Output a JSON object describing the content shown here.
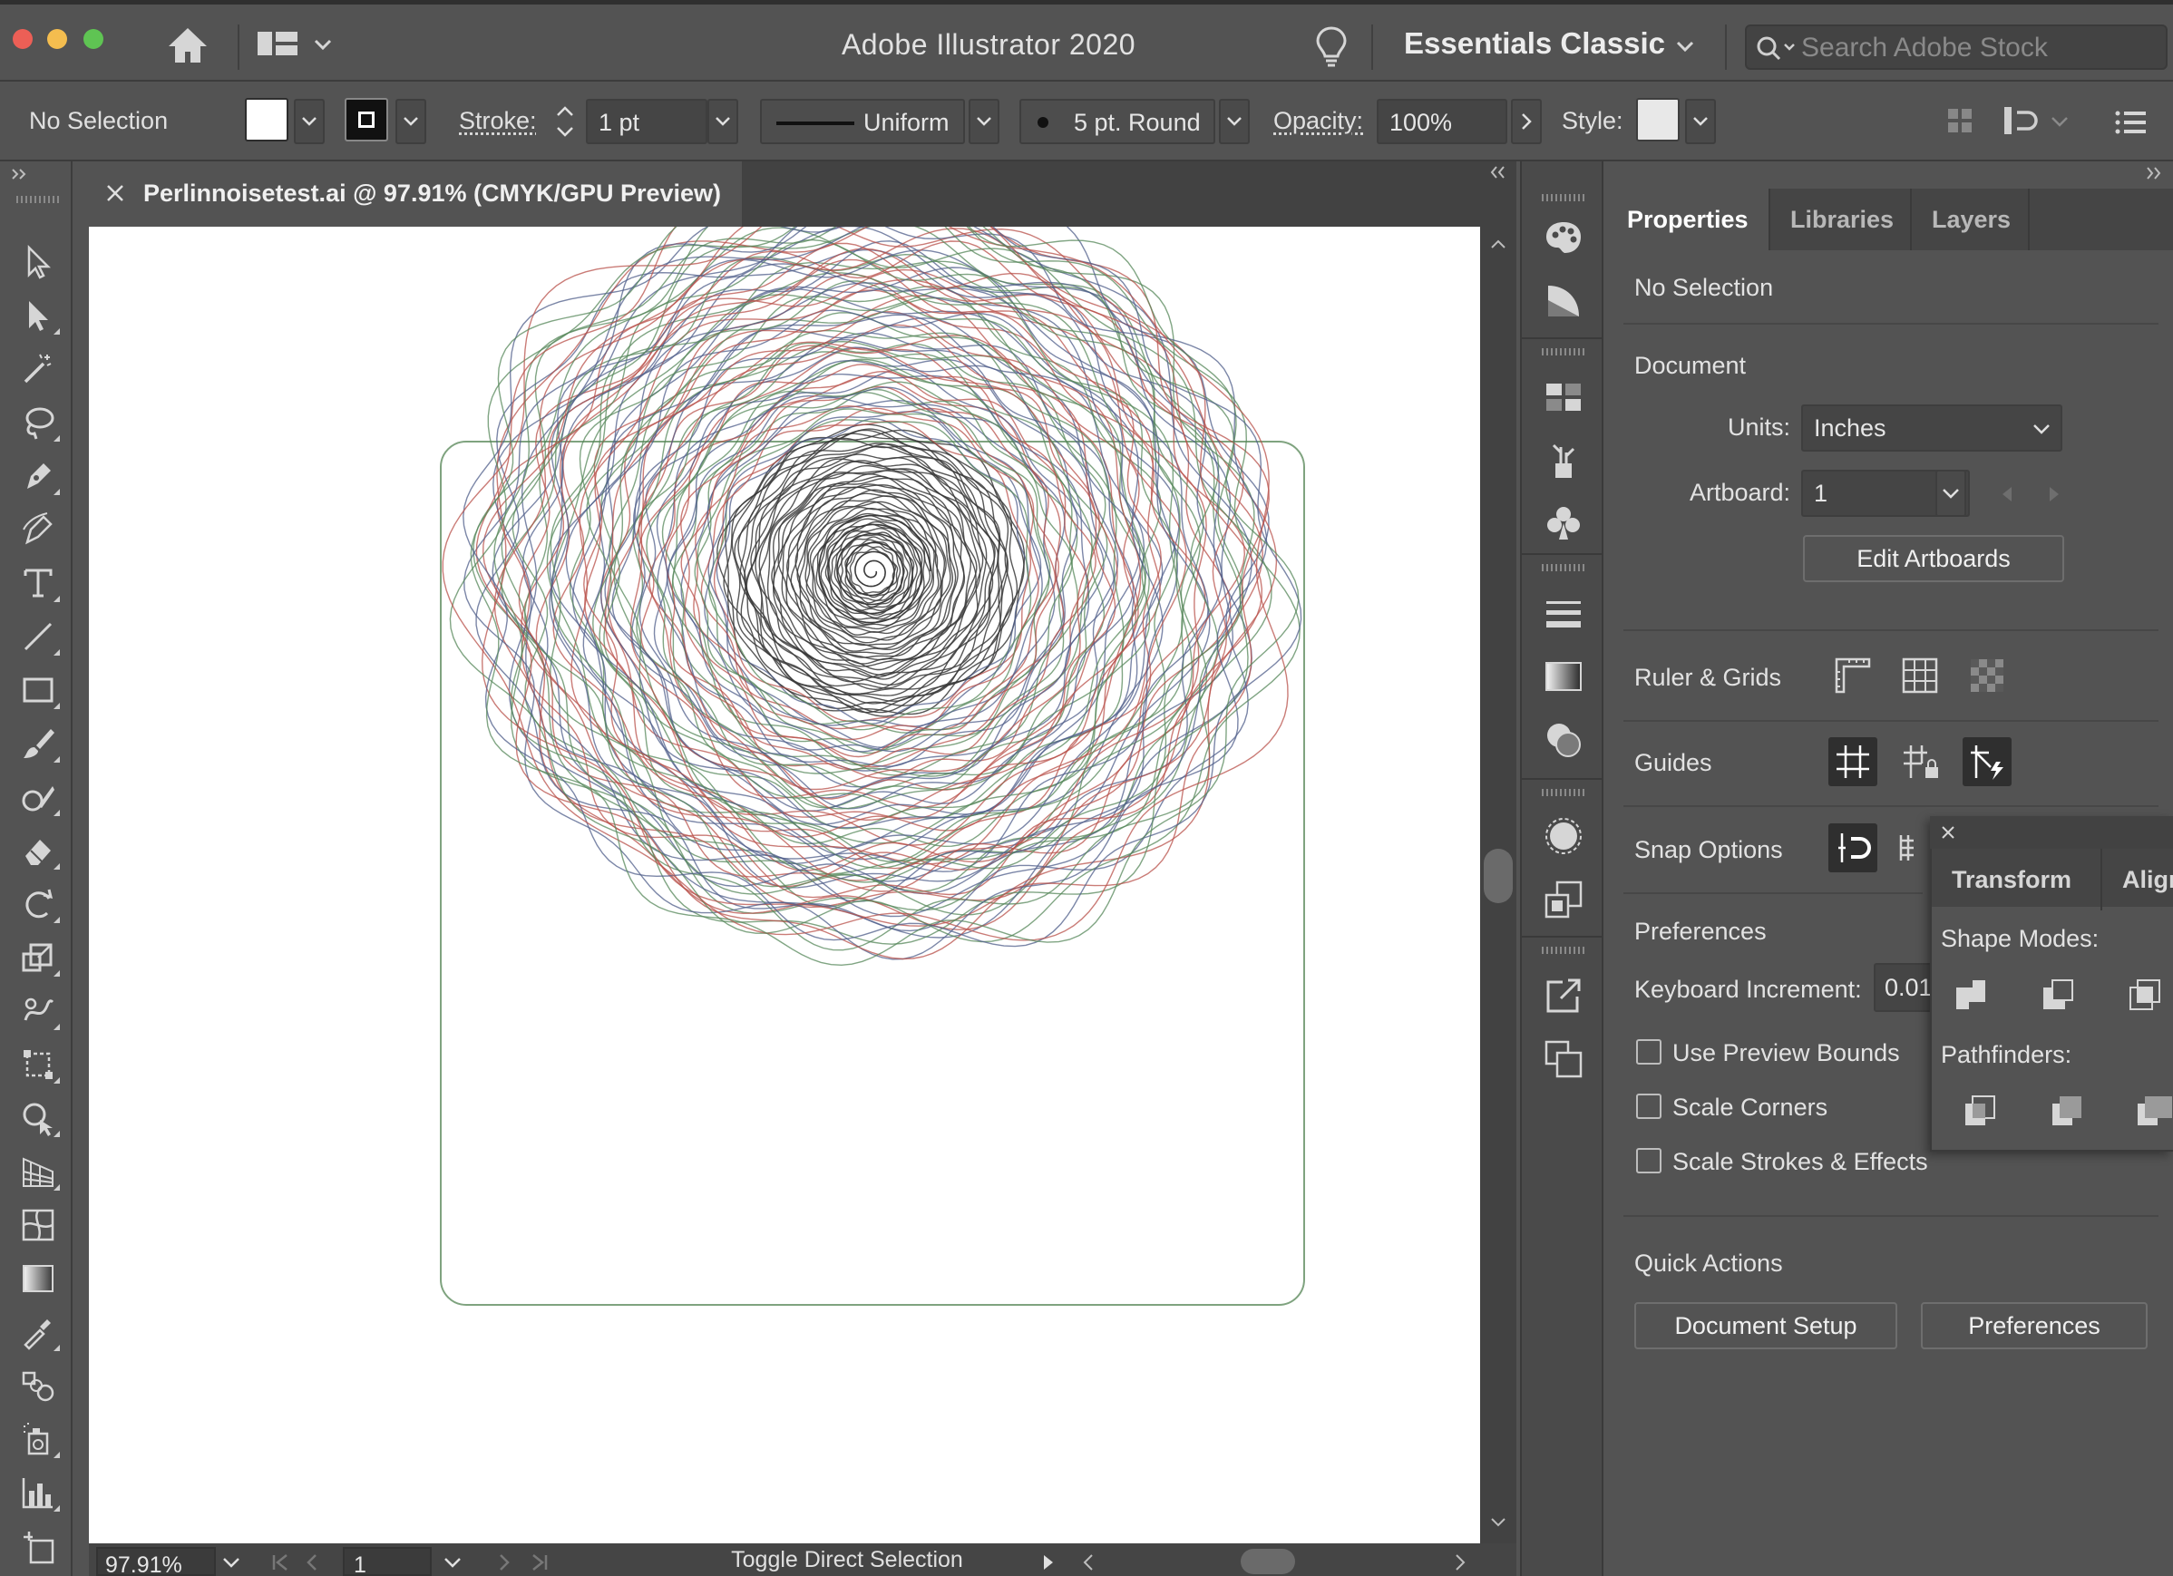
{
  "window": {
    "title": "Adobe Illustrator 2020",
    "workspace": "Essentials Classic",
    "stock_search_placeholder": "Search Adobe Stock",
    "traffic_lights": {
      "close": "#ec5f56",
      "minimize": "#f4bd4f",
      "zoom": "#5fc453"
    }
  },
  "control_bar": {
    "selection": "No Selection",
    "stroke_label": "Stroke:",
    "stroke_weight": "1 pt",
    "profile": "Uniform",
    "brush": "5 pt. Round",
    "opacity_label": "Opacity:",
    "opacity": "100%",
    "style_label": "Style:"
  },
  "document": {
    "tab_title": "Perlinnoisetest.ai @ 97.91% (CMYK/GPU Preview)",
    "zoom": "97.91%",
    "artboard_number": "1",
    "status_text": "Toggle Direct Selection"
  },
  "tools": [
    "selection-tool-icon",
    "direct-selection-tool-icon",
    "magic-wand-tool-icon",
    "lasso-tool-icon",
    "pen-tool-icon",
    "curvature-tool-icon",
    "type-tool-icon",
    "line-segment-tool-icon",
    "rectangle-tool-icon",
    "paintbrush-tool-icon",
    "shaper-tool-icon",
    "eraser-tool-icon",
    "rotate-tool-icon",
    "scale-tool-icon",
    "warp-tool-icon",
    "free-transform-tool-icon",
    "shape-builder-tool-icon",
    "perspective-grid-tool-icon",
    "mesh-tool-icon",
    "gradient-tool-icon",
    "eyedropper-tool-icon",
    "blend-tool-icon",
    "symbol-sprayer-tool-icon",
    "column-graph-tool-icon",
    "artboard-tool-icon"
  ],
  "panel": {
    "tabs": [
      "Properties",
      "Libraries",
      "Layers"
    ],
    "active_tab": "Properties",
    "selection_label": "No Selection",
    "document_title": "Document",
    "units_label": "Units:",
    "units_value": "Inches",
    "artboard_label": "Artboard:",
    "artboard_value": "1",
    "edit_artboards": "Edit Artboards",
    "ruler_grids": "Ruler & Grids",
    "guides": "Guides",
    "snap_options": "Snap Options",
    "preferences_title": "Preferences",
    "keyboard_increment_label": "Keyboard Increment:",
    "keyboard_increment_value": "0.01",
    "use_preview_bounds": "Use Preview Bounds",
    "scale_corners": "Scale Corners",
    "scale_strokes": "Scale Strokes & Effects",
    "quick_actions": "Quick Actions",
    "document_setup": "Document Setup",
    "preferences_button": "Preferences"
  },
  "float_panel": {
    "tabs": [
      "Transform",
      "Align"
    ],
    "shape_modes": "Shape Modes:",
    "pathfinders": "Pathfinders:"
  },
  "artwork": {
    "stroke_colors": [
      "#4f5d8a",
      "#b8504a",
      "#55875a",
      "#3a3a3a"
    ],
    "artboard_border": "#7fa37f"
  }
}
